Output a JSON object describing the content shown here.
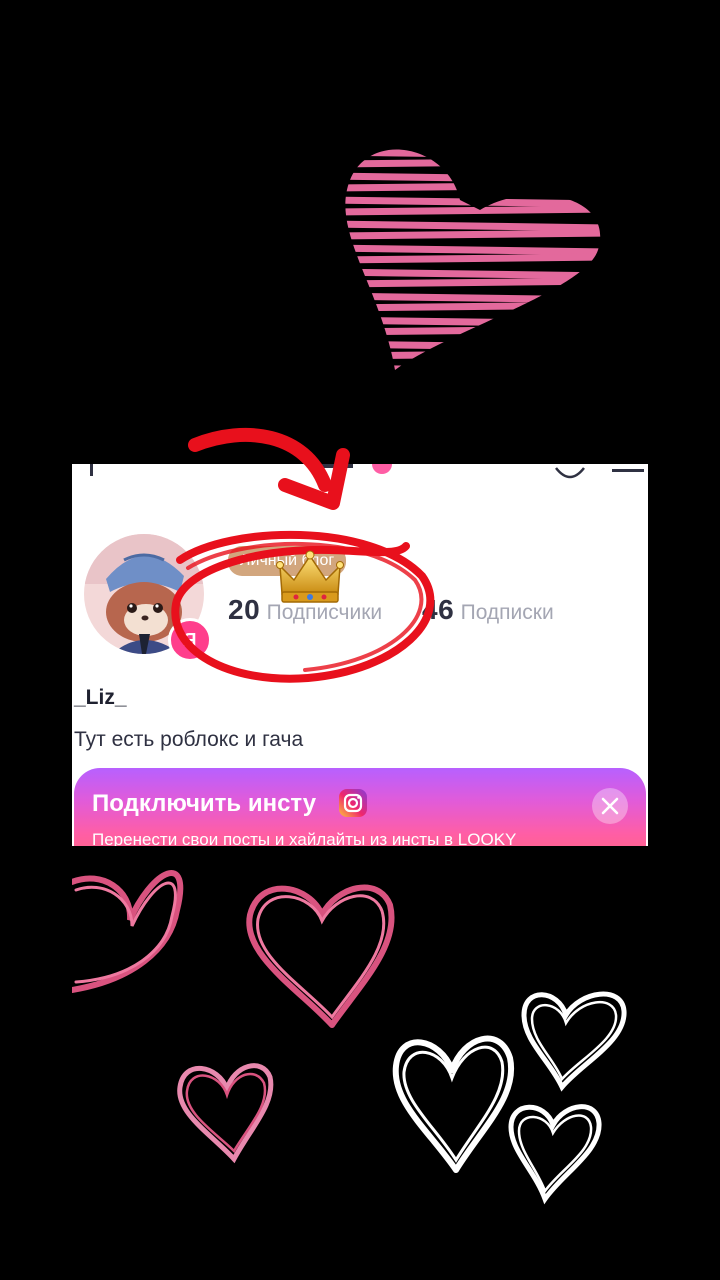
{
  "profile": {
    "category": "Личный блог",
    "followers": {
      "count": "20",
      "label": "Подписчики"
    },
    "following": {
      "count": "46",
      "label": "Подписки"
    },
    "avatar_badge": "Я",
    "username": "_Liz_",
    "bio": "Тут есть роблокс и гача"
  },
  "insta_banner": {
    "title": "Подключить инсту",
    "subtitle": "Перенести свои посты и хайлайты из инсты в LOOKY"
  },
  "colors": {
    "accent_pink": "#ff3e8c",
    "scribble_heart": "#f06fa5",
    "annotation_red": "#e8101c",
    "chip_tan": "#d2a67e"
  },
  "icons": [
    "instagram-icon",
    "close-icon",
    "crown-icon",
    "heart-icon",
    "menu-icon"
  ]
}
